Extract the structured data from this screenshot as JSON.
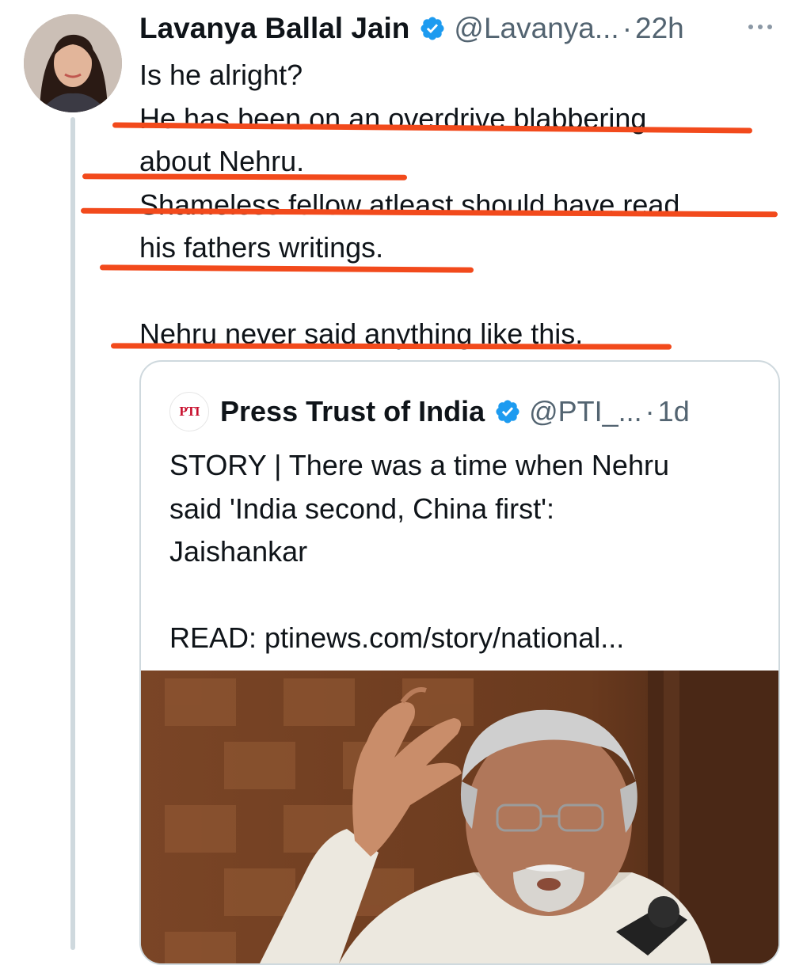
{
  "tweet": {
    "author_name": "Lavanya Ballal Jain",
    "handle": "@Lavanya...",
    "separator": "·",
    "time": "22h",
    "lines": [
      "Is he alright?",
      "He has been on an overdrive blabbering",
      "about Nehru.",
      "Shameless fellow atleast should have read",
      "his fathers writings.",
      "",
      "Nehru never said anything like this."
    ]
  },
  "quoted_tweet": {
    "logo_text": "PTI",
    "author_name": "Press Trust of India",
    "handle": "@PTI_...",
    "separator": "·",
    "time": "1d",
    "lines": [
      "STORY | There was a time when Nehru",
      "said 'India second, China first':",
      "Jaishankar",
      "",
      "READ: ptinews.com/story/national..."
    ]
  },
  "icons": {
    "verified": "verified-badge-icon",
    "more": "more-options-icon"
  },
  "colors": {
    "verified_blue": "#1d9bf0",
    "annotation_red": "#f24a1c",
    "secondary_text": "#536471",
    "border": "#cfd9de"
  }
}
